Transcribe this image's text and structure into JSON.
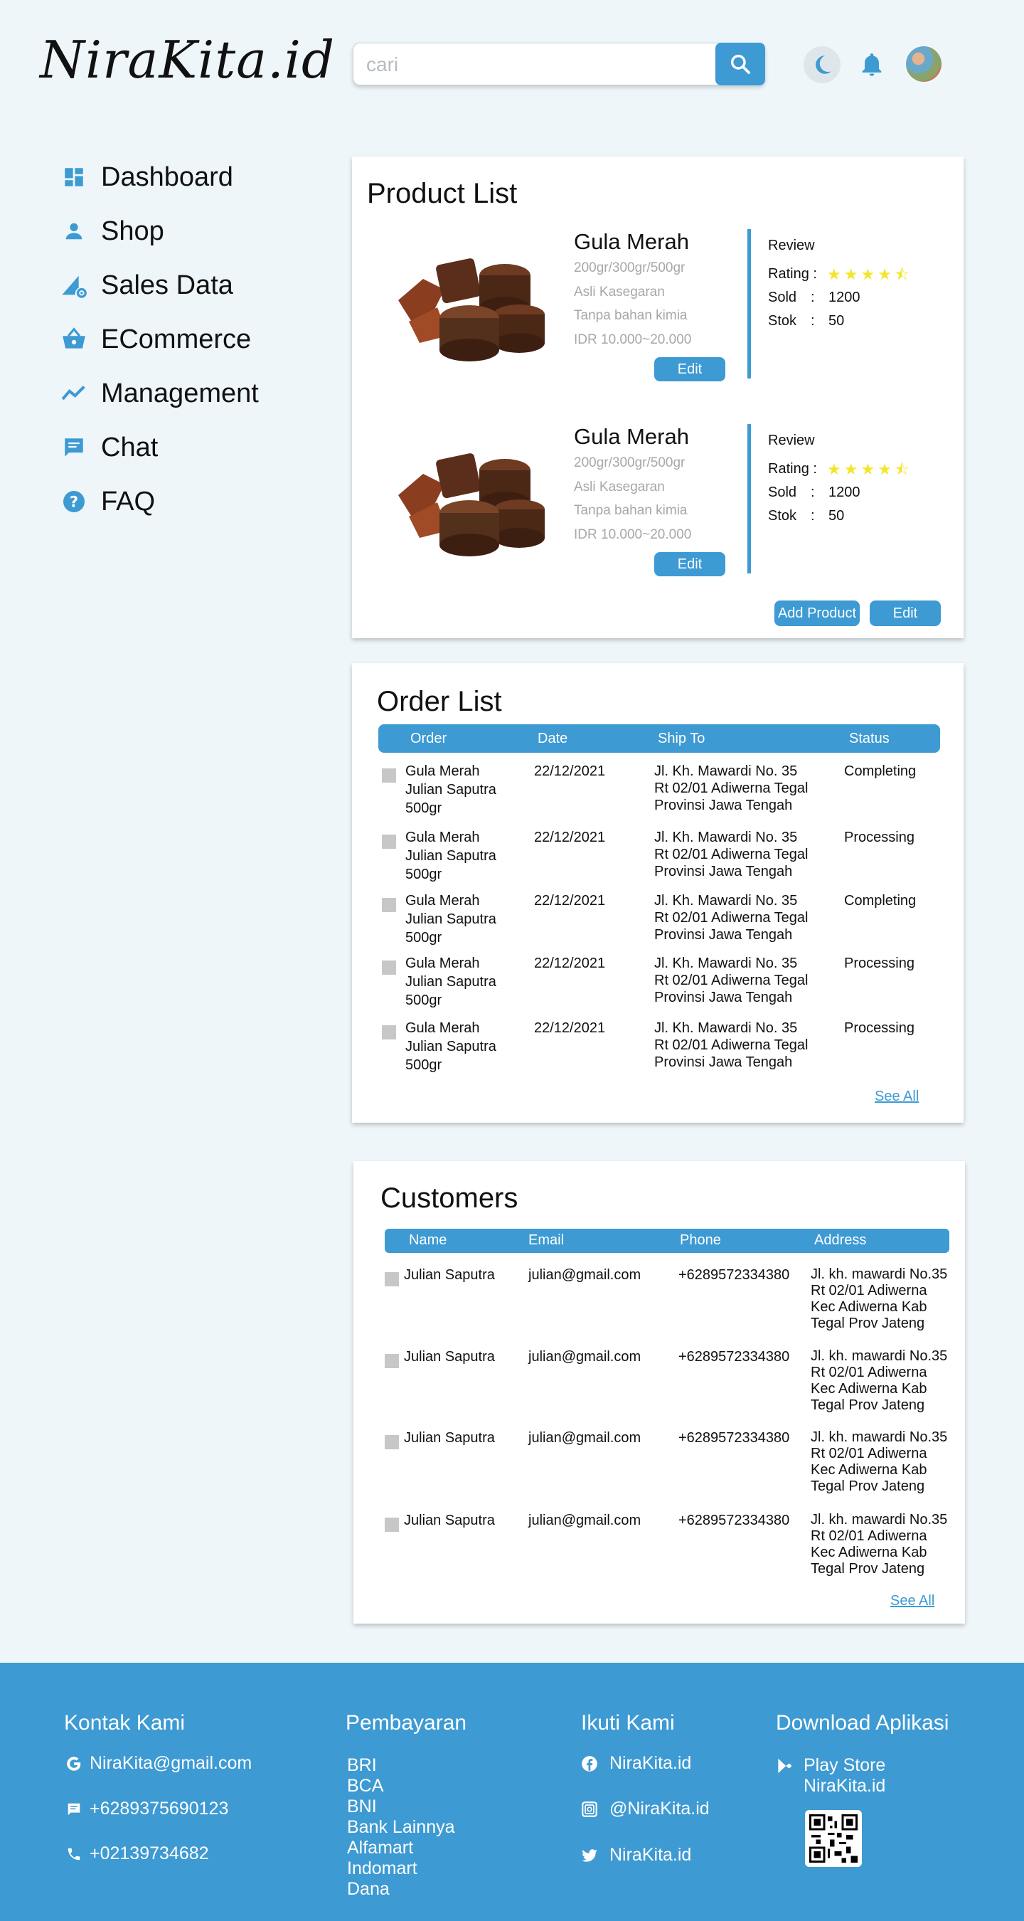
{
  "header": {
    "logo": "NiraKita.id",
    "search_placeholder": "cari"
  },
  "sidebar": {
    "items": [
      {
        "label": "Dashboard",
        "icon": "dashboard-icon"
      },
      {
        "label": "Shop",
        "icon": "person-icon"
      },
      {
        "label": "Sales Data",
        "icon": "sales-chart-icon"
      },
      {
        "label": "ECommerce",
        "icon": "basket-icon"
      },
      {
        "label": "Management",
        "icon": "trend-line-icon"
      },
      {
        "label": "Chat",
        "icon": "chat-icon"
      },
      {
        "label": "FAQ",
        "icon": "help-icon"
      }
    ]
  },
  "product_list": {
    "title": "Product List",
    "products": [
      {
        "name": "Gula Merah",
        "sizes": "200gr/300gr/500gr",
        "desc1": "Asli Kasegaran",
        "desc2": "Tanpa bahan kimia",
        "price": "IDR 10.000~20.000",
        "edit_label": "Edit",
        "review_label": "Review",
        "rating_label": "Rating :",
        "rating": 4.5,
        "sold_label": "Sold",
        "sold_sep": ":",
        "sold": "1200",
        "stock_label": "Stok",
        "stock_sep": ":",
        "stock": "50"
      },
      {
        "name": "Gula Merah",
        "sizes": "200gr/300gr/500gr",
        "desc1": "Asli Kasegaran",
        "desc2": "Tanpa bahan kimia",
        "price": "IDR 10.000~20.000",
        "edit_label": "Edit",
        "review_label": "Review",
        "rating_label": "Rating :",
        "rating": 4.5,
        "sold_label": "Sold",
        "sold_sep": ":",
        "sold": "1200",
        "stock_label": "Stok",
        "stock_sep": ":",
        "stock": "50"
      }
    ],
    "add_product_label": "Add Product",
    "edit_label": "Edit"
  },
  "order_list": {
    "title": "Order List",
    "columns": [
      "Order",
      "Date",
      "Ship To",
      "Status"
    ],
    "rows": [
      {
        "order": [
          "Gula Merah",
          "Julian Saputra",
          "500gr"
        ],
        "date": "22/12/2021",
        "ship": [
          "Jl. Kh. Mawardi No. 35",
          "Rt 02/01 Adiwerna Tegal",
          "Provinsi Jawa Tengah"
        ],
        "status": "Completing"
      },
      {
        "order": [
          "Gula Merah",
          "Julian Saputra",
          "500gr"
        ],
        "date": "22/12/2021",
        "ship": [
          "Jl. Kh. Mawardi No. 35",
          "Rt 02/01 Adiwerna Tegal",
          "Provinsi Jawa Tengah"
        ],
        "status": "Processing"
      },
      {
        "order": [
          "Gula Merah",
          "Julian Saputra",
          "500gr"
        ],
        "date": "22/12/2021",
        "ship": [
          "Jl. Kh. Mawardi No. 35",
          "Rt 02/01 Adiwerna Tegal",
          "Provinsi Jawa Tengah"
        ],
        "status": "Completing"
      },
      {
        "order": [
          "Gula Merah",
          "Julian Saputra",
          "500gr"
        ],
        "date": "22/12/2021",
        "ship": [
          "Jl. Kh. Mawardi No. 35",
          "Rt 02/01 Adiwerna Tegal",
          "Provinsi Jawa Tengah"
        ],
        "status": "Processing"
      },
      {
        "order": [
          "Gula Merah",
          "Julian Saputra",
          "500gr"
        ],
        "date": "22/12/2021",
        "ship": [
          "Jl. Kh. Mawardi No. 35",
          "Rt 02/01 Adiwerna Tegal",
          "Provinsi Jawa Tengah"
        ],
        "status": "Processing"
      }
    ],
    "see_all": "See All"
  },
  "customers": {
    "title": "Customers",
    "columns": [
      "Name",
      "Email",
      "Phone",
      "Address"
    ],
    "rows": [
      {
        "name": "Julian Saputra",
        "email": "julian@gmail.com",
        "phone": "+6289572334380",
        "address": [
          "Jl. kh. mawardi No.35",
          "Rt 02/01 Adiwerna",
          "Kec Adiwerna Kab",
          "Tegal Prov Jateng"
        ]
      },
      {
        "name": "Julian Saputra",
        "email": "julian@gmail.com",
        "phone": "+6289572334380",
        "address": [
          "Jl. kh. mawardi No.35",
          "Rt 02/01 Adiwerna",
          "Kec Adiwerna Kab",
          "Tegal Prov Jateng"
        ]
      },
      {
        "name": "Julian Saputra",
        "email": "julian@gmail.com",
        "phone": "+6289572334380",
        "address": [
          "Jl. kh. mawardi No.35",
          "Rt 02/01 Adiwerna",
          "Kec Adiwerna Kab",
          "Tegal Prov Jateng"
        ]
      },
      {
        "name": "Julian Saputra",
        "email": "julian@gmail.com",
        "phone": "+6289572334380",
        "address": [
          "Jl. kh. mawardi No.35",
          "Rt 02/01 Adiwerna",
          "Kec Adiwerna Kab",
          "Tegal Prov Jateng"
        ]
      }
    ],
    "see_all": "See All"
  },
  "footer": {
    "contact": {
      "title": "Kontak Kami",
      "email": "NiraKita@gmail.com",
      "sms": "+6289375690123",
      "phone": "+02139734682"
    },
    "payment": {
      "title": "Pembayaran",
      "methods": [
        "BRI",
        "BCA",
        "BNI",
        "Bank Lainnya",
        "Alfamart",
        "Indomart",
        "Dana"
      ]
    },
    "follow": {
      "title": "Ikuti Kami",
      "facebook": "NiraKita.id",
      "instagram": "@NiraKita.id",
      "twitter": "NiraKita.id"
    },
    "download": {
      "title": "Download Aplikasi",
      "store_line1": "Play Store",
      "store_line2": "NiraKita.id"
    }
  },
  "colors": {
    "accent": "#3d9ad3",
    "background": "#eef6fa",
    "star": "#f3e52c",
    "muted_text": "#a7a7a7"
  }
}
